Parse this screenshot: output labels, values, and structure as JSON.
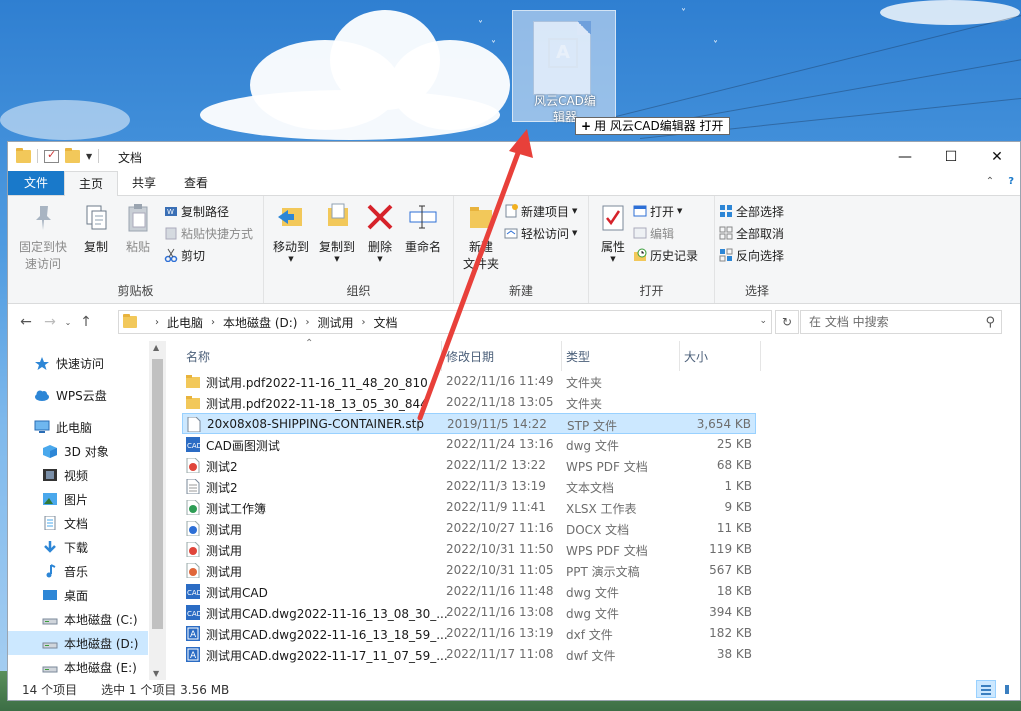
{
  "drag": {
    "ghost_label_line1": "风云CAD编",
    "ghost_label_line2": "辑器",
    "tooltip_plus": "+",
    "tooltip_text": "用 风云CAD编辑器 打开"
  },
  "window": {
    "title": "文档",
    "controls": {
      "minimize": "—",
      "maximize": "☐",
      "close": "✕"
    }
  },
  "ribbon_tabs": [
    {
      "label": "文件"
    },
    {
      "label": "主页"
    },
    {
      "label": "共享"
    },
    {
      "label": "查看"
    }
  ],
  "ribbon": {
    "clipboard": {
      "group_label": "剪贴板",
      "pin_label_1": "固定到快",
      "pin_label_2": "速访问",
      "copy_label": "复制",
      "paste_label": "粘贴",
      "copy_path": "复制路径",
      "paste_shortcut": "粘贴快捷方式",
      "cut": "剪切"
    },
    "organize": {
      "group_label": "组织",
      "move_to": "移动到",
      "copy_to": "复制到",
      "delete": "删除",
      "rename": "重命名"
    },
    "new": {
      "group_label": "新建",
      "new_folder_1": "新建",
      "new_folder_2": "文件夹",
      "new_item": "新建项目",
      "easy_access": "轻松访问"
    },
    "open": {
      "group_label": "打开",
      "properties": "属性",
      "open": "打开",
      "edit": "编辑",
      "history": "历史记录"
    },
    "select": {
      "group_label": "选择",
      "select_all": "全部选择",
      "select_none": "全部取消",
      "invert": "反向选择"
    }
  },
  "address": {
    "crumbs": [
      "此电脑",
      "本地磁盘 (D:)",
      "测试用",
      "文档"
    ],
    "search_placeholder": "在 文档 中搜索"
  },
  "nav_items": [
    {
      "label": "快速访问",
      "icon": "star-icon"
    },
    {
      "label": "WPS云盘",
      "icon": "cloud-icon"
    },
    {
      "label": "此电脑",
      "icon": "computer-icon"
    },
    {
      "label": "3D 对象",
      "icon": "cube-icon"
    },
    {
      "label": "视频",
      "icon": "video-icon"
    },
    {
      "label": "图片",
      "icon": "picture-icon"
    },
    {
      "label": "文档",
      "icon": "document-icon"
    },
    {
      "label": "下载",
      "icon": "download-icon"
    },
    {
      "label": "音乐",
      "icon": "music-icon"
    },
    {
      "label": "桌面",
      "icon": "desktop-icon"
    },
    {
      "label": "本地磁盘 (C:)",
      "icon": "drive-icon"
    },
    {
      "label": "本地磁盘 (D:)",
      "icon": "drive-icon"
    },
    {
      "label": "本地磁盘 (E:)",
      "icon": "drive-icon"
    }
  ],
  "columns": {
    "name": "名称",
    "date": "修改日期",
    "type": "类型",
    "size": "大小"
  },
  "files": [
    {
      "name": "测试用.pdf2022-11-16_11_48_20_810",
      "date": "2022/11/16 11:49",
      "type": "文件夹",
      "size": "",
      "icon": "folder-icon",
      "color": "#f2c85a"
    },
    {
      "name": "测试用.pdf2022-11-18_13_05_30_844",
      "date": "2022/11/18 13:05",
      "type": "文件夹",
      "size": "",
      "icon": "folder-icon",
      "color": "#f2c85a"
    },
    {
      "name": "20x08x08-SHIPPING-CONTAINER.stp",
      "date": "2019/11/5 14:22",
      "type": "STP 文件",
      "size": "3,654 KB",
      "icon": "blank-file-icon",
      "color": "#ffffff"
    },
    {
      "name": "CAD画图测试",
      "date": "2022/11/24 13:16",
      "type": "dwg 文件",
      "size": "25 KB",
      "icon": "cad-file-icon",
      "color": "#2b6cc4"
    },
    {
      "name": "测试2",
      "date": "2022/11/2 13:22",
      "type": "WPS PDF 文档",
      "size": "68 KB",
      "icon": "pdf-file-icon",
      "color": "#e0453a"
    },
    {
      "name": "测试2",
      "date": "2022/11/3 13:19",
      "type": "文本文档",
      "size": "1 KB",
      "icon": "text-file-icon",
      "color": "#ffffff"
    },
    {
      "name": "测试工作簿",
      "date": "2022/11/9 11:41",
      "type": "XLSX 工作表",
      "size": "9 KB",
      "icon": "xlsx-file-icon",
      "color": "#2e9d55"
    },
    {
      "name": "测试用",
      "date": "2022/10/27 11:16",
      "type": "DOCX 文档",
      "size": "11 KB",
      "icon": "docx-file-icon",
      "color": "#2d6fd6"
    },
    {
      "name": "测试用",
      "date": "2022/10/31 11:50",
      "type": "WPS PDF 文档",
      "size": "119 KB",
      "icon": "pdf-file-icon",
      "color": "#e0453a"
    },
    {
      "name": "测试用",
      "date": "2022/10/31 11:05",
      "type": "PPT 演示文稿",
      "size": "567 KB",
      "icon": "ppt-file-icon",
      "color": "#e0663a"
    },
    {
      "name": "测试用CAD",
      "date": "2022/11/16 11:48",
      "type": "dwg 文件",
      "size": "18 KB",
      "icon": "cad-file-icon",
      "color": "#2b6cc4"
    },
    {
      "name": "测试用CAD.dwg2022-11-16_13_08_30_...",
      "date": "2022/11/16 13:08",
      "type": "dwg 文件",
      "size": "394 KB",
      "icon": "cad-file-icon",
      "color": "#2b6cc4"
    },
    {
      "name": "测试用CAD.dwg2022-11-16_13_18_59_...",
      "date": "2022/11/16 13:19",
      "type": "dxf 文件",
      "size": "182 KB",
      "icon": "cad-a-file-icon",
      "color": "#2b6cc4"
    },
    {
      "name": "测试用CAD.dwg2022-11-17_11_07_59_...",
      "date": "2022/11/17 11:08",
      "type": "dwf 文件",
      "size": "38 KB",
      "icon": "cad-a-file-icon",
      "color": "#2b6cc4"
    }
  ],
  "status": {
    "count": "14 个项目",
    "selection": "选中 1 个项目  3.56 MB"
  },
  "colors": {
    "accent": "#1979ca",
    "selection": "#cce8ff",
    "arrow": "#e8403a"
  }
}
